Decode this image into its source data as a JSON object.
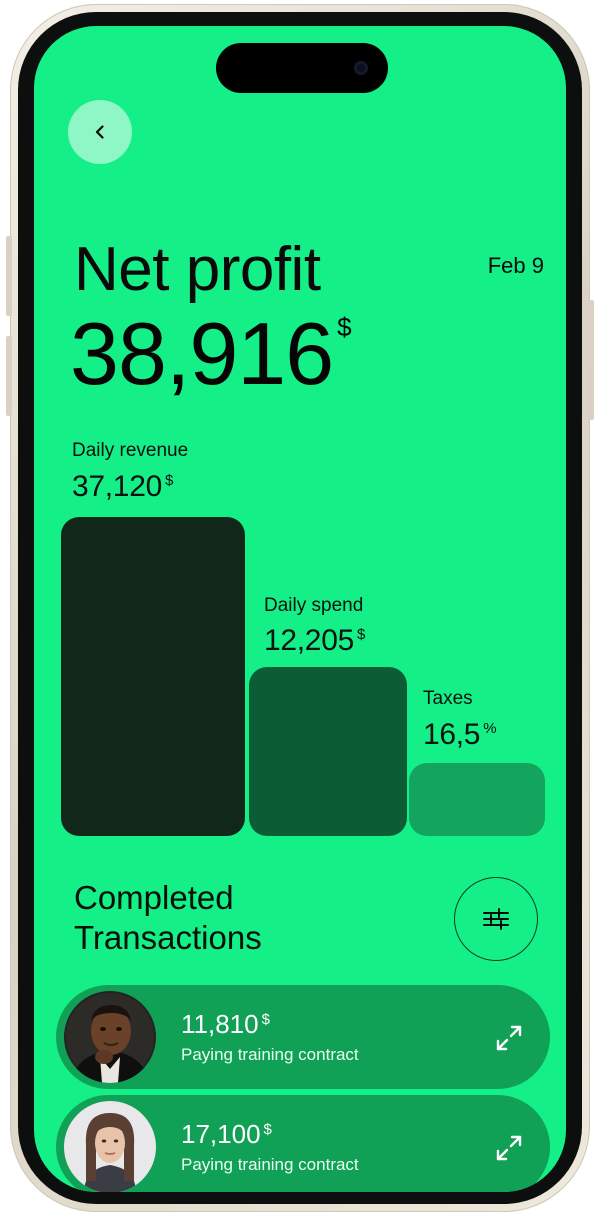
{
  "header": {
    "back_icon": "chevron-left-icon",
    "title": "Net profit",
    "date": "Feb 9"
  },
  "net_profit": {
    "amount": "38,916",
    "unit": "$"
  },
  "metrics": [
    {
      "label": "Daily revenue",
      "value": "37,120",
      "unit": "$"
    },
    {
      "label": "Daily spend",
      "value": "12,205",
      "unit": "$"
    },
    {
      "label": "Taxes",
      "value": "16,5",
      "unit": "%"
    }
  ],
  "colors": {
    "screen_bg": "#14ef88",
    "bar_revenue": "#10271a",
    "bar_spend": "#0c5c36",
    "bar_taxes": "#13a45e",
    "transaction_bg": "#10a157"
  },
  "transactions_section": {
    "title_line1": "Completed",
    "title_line2": "Transactions",
    "filter_icon": "sliders-icon"
  },
  "transactions": [
    {
      "amount": "11,810",
      "unit": "$",
      "description": "Paying training contract",
      "icon": "expand-icon"
    },
    {
      "amount": "17,100",
      "unit": "$",
      "description": "Paying training contract",
      "icon": "expand-icon"
    }
  ]
}
